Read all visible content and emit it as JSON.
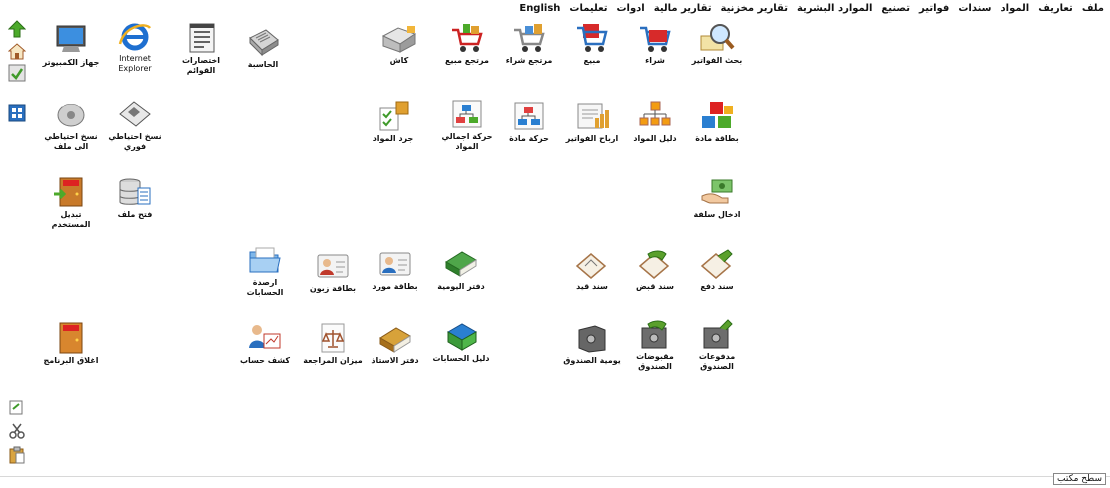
{
  "menu": [
    "ملف",
    "تعاريف",
    "المواد",
    "سندات",
    "فواتير",
    "تصنيع",
    "الموارد البشرية",
    "تقارير مخزنية",
    "تقارير مالية",
    "ادوات",
    "تعليمات",
    "English"
  ],
  "icons": {
    "invoice_search": "بحث الفواتير",
    "purchase": "شراء",
    "sale": "مبيع",
    "purchase_return": "مرتجع شراء",
    "sale_return": "مرتجع مبيع",
    "cashier": "كاش",
    "calculator": "الحاسبة",
    "list_shortcuts": "اختصارات\nالقوائم",
    "ie": "Internet\nExplorer",
    "my_computer": "جهاز الكمبيوتر",
    "material_card": "بطاقة مادة",
    "material_guide": "دليل المواد",
    "invoice_profits": "ارباح الفواتير",
    "material_movement": "حركة مادة",
    "total_movement": "حركة اجمالي\nالمواد",
    "inventory": "جرد المواد",
    "instant_backup": "نسخ احتياطي\nفوري",
    "backup_to_file": "نسخ احتياطي\nالى ملف",
    "advance_entry": "ادخال سلفة",
    "open_file": "فتح ملف",
    "switch_user": "تبديل المستخدم",
    "payment_voucher": "سند دفع",
    "receipt_voucher": "سند قبض",
    "journal_voucher": "سند قيد",
    "daybook": "دفتر اليومية",
    "supplier_card": "بطاقة مورد",
    "customer_card": "بطاقة زبون",
    "account_balances": "ارصدة\nالحسابات",
    "cash_payments": "مدفوعات\nالصندوق",
    "cash_receipts": "مقبوضات\nالصندوق",
    "cash_daily": "يومية الصندوق",
    "accounts_guide": "دليل الحسابات",
    "ledger": "دفتر الاستاذ",
    "trial_balance": "ميزان المراجعة",
    "account_statement": "كشف حساب",
    "exit_program": "اغلاق البرنامج"
  },
  "status": {
    "desktop": "سطح مكتب"
  },
  "colors": {
    "accent": "#2a7fd1",
    "green": "#5aa02c",
    "red": "#d22b2b"
  }
}
